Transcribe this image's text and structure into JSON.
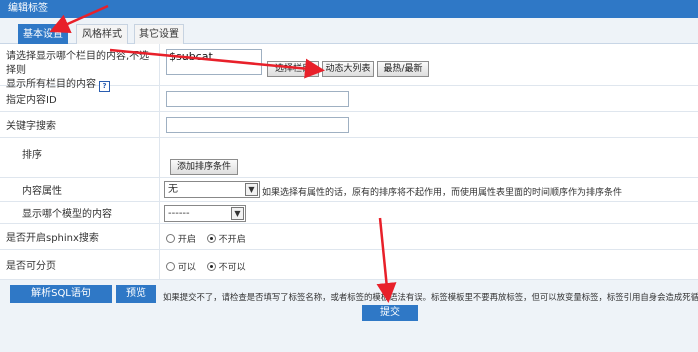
{
  "window": {
    "title": "编辑标签"
  },
  "tabs": [
    {
      "label": "基本设置",
      "active": true
    },
    {
      "label": "风格样式",
      "active": false
    },
    {
      "label": "其它设置",
      "active": false
    }
  ],
  "form": {
    "column_row": {
      "label_line1": "请选择显示哪个栏目的内容,不选择则",
      "label_line2": "显示所有栏目的内容",
      "help_icon": "?",
      "value": "$subcat",
      "btn_select": "选择栏目",
      "btn_dynamic": "动态大列表",
      "btn_hot": "最热/最新"
    },
    "content_id": {
      "label": "指定内容ID",
      "value": ""
    },
    "keyword": {
      "label": "关键字搜索",
      "value": ""
    },
    "sort": {
      "label": "排序",
      "button": "添加排序条件"
    },
    "attribute": {
      "label": "内容属性",
      "selected": "无",
      "hint": "如果选择有属性的话，原有的排序将不起作用，而使用属性表里面的时间顺序作为排序条件"
    },
    "model": {
      "label": "显示哪个模型的内容",
      "selected": "------"
    },
    "sphinx": {
      "label": "是否开启sphinx搜索",
      "on_label": "开启",
      "off_label": "不开启",
      "value": "off"
    },
    "paging": {
      "label": "是否可分页",
      "on_label": "可以",
      "off_label": "不可以",
      "value": "off"
    }
  },
  "footer": {
    "parse_sql": "解析SQL语句",
    "preview": "预览",
    "notice": "如果提交不了，请检查是否填写了标签名称，或者标签的模板语法有误。标签模板里不要再放标签，但可以放变量标签，标签引用自身会造成死循环。",
    "submit": "提交"
  },
  "colors": {
    "accent": "#2f78c6",
    "annotation_arrow": "#e8202a"
  }
}
